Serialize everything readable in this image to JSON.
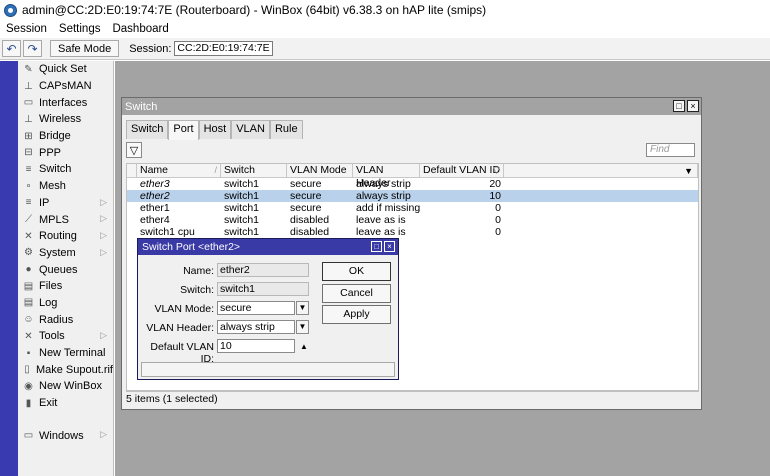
{
  "titlebar": {
    "title": "admin@CC:2D:E0:19:74:7E (Routerboard) - WinBox (64bit) v6.38.3 on hAP lite (smips)"
  },
  "menu": {
    "session": "Session",
    "settings": "Settings",
    "dashboard": "Dashboard"
  },
  "toolbar": {
    "safe_mode": "Safe Mode",
    "session_label": "Session:",
    "session_value": "CC:2D:E0:19:74:7E"
  },
  "sidebar": {
    "items": [
      {
        "label": "Quick Set",
        "icon": "quickset-icon",
        "arrow": false
      },
      {
        "label": "CAPsMAN",
        "icon": "capsman-icon",
        "arrow": false
      },
      {
        "label": "Interfaces",
        "icon": "interfaces-icon",
        "arrow": false
      },
      {
        "label": "Wireless",
        "icon": "wireless-icon",
        "arrow": false
      },
      {
        "label": "Bridge",
        "icon": "bridge-icon",
        "arrow": false
      },
      {
        "label": "PPP",
        "icon": "ppp-icon",
        "arrow": false
      },
      {
        "label": "Switch",
        "icon": "switch-icon",
        "arrow": false
      },
      {
        "label": "Mesh",
        "icon": "mesh-icon",
        "arrow": false
      },
      {
        "label": "IP",
        "icon": "ip-icon",
        "arrow": true
      },
      {
        "label": "MPLS",
        "icon": "mpls-icon",
        "arrow": true
      },
      {
        "label": "Routing",
        "icon": "routing-icon",
        "arrow": true
      },
      {
        "label": "System",
        "icon": "system-icon",
        "arrow": true
      },
      {
        "label": "Queues",
        "icon": "queues-icon",
        "arrow": false
      },
      {
        "label": "Files",
        "icon": "files-icon",
        "arrow": false
      },
      {
        "label": "Log",
        "icon": "log-icon",
        "arrow": false
      },
      {
        "label": "Radius",
        "icon": "radius-icon",
        "arrow": false
      },
      {
        "label": "Tools",
        "icon": "tools-icon",
        "arrow": true
      },
      {
        "label": "New Terminal",
        "icon": "terminal-icon",
        "arrow": false
      },
      {
        "label": "Make Supout.rif",
        "icon": "supout-icon",
        "arrow": false
      },
      {
        "label": "New WinBox",
        "icon": "winbox-icon",
        "arrow": false
      },
      {
        "label": "Exit",
        "icon": "exit-icon",
        "arrow": false
      }
    ],
    "windows": {
      "label": "Windows",
      "icon": "windows-icon",
      "arrow": true
    }
  },
  "switch_window": {
    "title": "Switch",
    "tabs": [
      "Switch",
      "Port",
      "Host",
      "VLAN",
      "Rule"
    ],
    "active_tab": "Port",
    "find_placeholder": "Find",
    "columns": [
      "Name",
      "Switch",
      "VLAN Mode",
      "VLAN Header",
      "Default VLAN ID"
    ],
    "rows": [
      {
        "name": "ether3",
        "switch": "switch1",
        "vlan_mode": "secure",
        "vlan_header": "always strip",
        "default_vlan_id": "20",
        "italic": true,
        "selected": false
      },
      {
        "name": "ether2",
        "switch": "switch1",
        "vlan_mode": "secure",
        "vlan_header": "always strip",
        "default_vlan_id": "10",
        "italic": true,
        "selected": true
      },
      {
        "name": "ether1",
        "switch": "switch1",
        "vlan_mode": "secure",
        "vlan_header": "add if missing",
        "default_vlan_id": "0",
        "italic": false,
        "selected": false
      },
      {
        "name": "ether4",
        "switch": "switch1",
        "vlan_mode": "disabled",
        "vlan_header": "leave as is",
        "default_vlan_id": "0",
        "italic": false,
        "selected": false
      },
      {
        "name": "switch1 cpu",
        "switch": "switch1",
        "vlan_mode": "disabled",
        "vlan_header": "leave as is",
        "default_vlan_id": "0",
        "italic": false,
        "selected": false
      }
    ],
    "status": "5 items (1 selected)"
  },
  "dialog": {
    "title": "Switch Port <ether2>",
    "name_label": "Name:",
    "name_value": "ether2",
    "switch_label": "Switch:",
    "switch_value": "switch1",
    "vlan_mode_label": "VLAN Mode:",
    "vlan_mode_value": "secure",
    "vlan_header_label": "VLAN Header:",
    "vlan_header_value": "always strip",
    "default_vlan_label": "Default VLAN ID:",
    "default_vlan_value": "10",
    "ok": "OK",
    "cancel": "Cancel",
    "apply": "Apply"
  },
  "colors": {
    "left_strip": "#3a3ab0",
    "dialog_title": "#3a3aa6",
    "selected_row": "#b9d1ea",
    "workspace": "#a3a3a3"
  }
}
